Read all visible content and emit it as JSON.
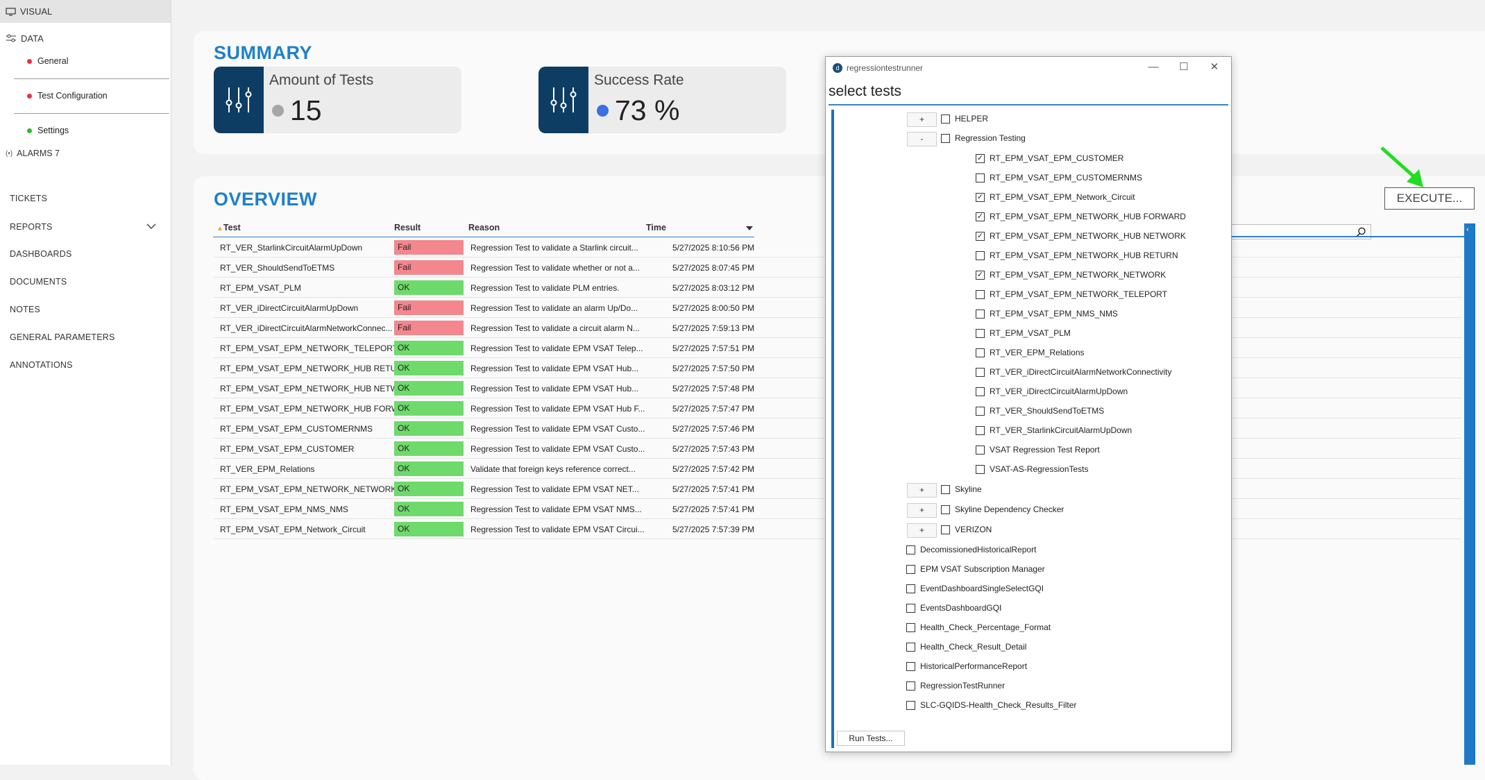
{
  "sidebar": {
    "visual_label": "VISUAL",
    "data_label": "DATA",
    "sub_items": [
      {
        "label": "General",
        "status_color": "#e8323f"
      },
      {
        "label": "Test Configuration",
        "status_color": "#e8323f"
      },
      {
        "label": "Settings",
        "status_color": "#2eb82e"
      }
    ],
    "alarms_label": "ALARMS 7",
    "nav": [
      "TICKETS",
      "REPORTS",
      "DASHBOARDS",
      "DOCUMENTS",
      "NOTES",
      "GENERAL PARAMETERS",
      "ANNOTATIONS"
    ]
  },
  "summary": {
    "title": "SUMMARY",
    "cards": [
      {
        "label": "Amount of Tests",
        "value": "15",
        "dot_color": "#a6a6a6",
        "icon": "sliders-icon"
      },
      {
        "label": "Success Rate",
        "value": "73 %",
        "dot_color": "#3c6fe0",
        "icon": "sliders-icon"
      }
    ]
  },
  "overview": {
    "title": "OVERVIEW",
    "execute_label": "EXECUTE...",
    "columns": [
      "Test",
      "Result",
      "Reason",
      "Time"
    ],
    "rows": [
      {
        "test": "RT_VER_StarlinkCircuitAlarmUpDown",
        "result": "Fail",
        "reason": "Regression Test to validate a Starlink circuit...",
        "time": "5/27/2025 8:10:56 PM"
      },
      {
        "test": "RT_VER_ShouldSendToETMS",
        "result": "Fail",
        "reason": "Regression Test to validate whether or not a...",
        "time": "5/27/2025 8:07:45 PM"
      },
      {
        "test": "RT_EPM_VSAT_PLM",
        "result": "OK",
        "reason": "Regression Test to validate PLM entries.",
        "time": "5/27/2025 8:03:12 PM"
      },
      {
        "test": "RT_VER_iDirectCircuitAlarmUpDown",
        "result": "Fail",
        "reason": "Regression Test to validate an alarm Up/Do...",
        "time": "5/27/2025 8:00:50 PM"
      },
      {
        "test": "RT_VER_iDirectCircuitAlarmNetworkConnec...",
        "result": "Fail",
        "reason": "Regression Test to validate a circuit alarm N...",
        "time": "5/27/2025 7:59:13 PM"
      },
      {
        "test": "RT_EPM_VSAT_EPM_NETWORK_TELEPORT",
        "result": "OK",
        "reason": "Regression Test to validate EPM VSAT Telep...",
        "time": "5/27/2025 7:57:51 PM"
      },
      {
        "test": "RT_EPM_VSAT_EPM_NETWORK_HUB RETURN",
        "result": "OK",
        "reason": "Regression Test to validate EPM VSAT Hub...",
        "time": "5/27/2025 7:57:50 PM"
      },
      {
        "test": "RT_EPM_VSAT_EPM_NETWORK_HUB NETW...",
        "result": "OK",
        "reason": "Regression Test to validate EPM VSAT Hub...",
        "time": "5/27/2025 7:57:48 PM"
      },
      {
        "test": "RT_EPM_VSAT_EPM_NETWORK_HUB FORW...",
        "result": "OK",
        "reason": "Regression Test to validate EPM VSAT Hub F...",
        "time": "5/27/2025 7:57:47 PM"
      },
      {
        "test": "RT_EPM_VSAT_EPM_CUSTOMERNMS",
        "result": "OK",
        "reason": "Regression Test to validate EPM VSAT Custo...",
        "time": "5/27/2025 7:57:46 PM"
      },
      {
        "test": "RT_EPM_VSAT_EPM_CUSTOMER",
        "result": "OK",
        "reason": "Regression Test to validate EPM VSAT Custo...",
        "time": "5/27/2025 7:57:43 PM"
      },
      {
        "test": "RT_VER_EPM_Relations",
        "result": "OK",
        "reason": "Validate that foreign keys reference correct...",
        "time": "5/27/2025 7:57:42 PM"
      },
      {
        "test": "RT_EPM_VSAT_EPM_NETWORK_NETWORK",
        "result": "OK",
        "reason": "Regression Test to validate EPM VSAT NET...",
        "time": "5/27/2025 7:57:41 PM"
      },
      {
        "test": "RT_EPM_VSAT_EPM_NMS_NMS",
        "result": "OK",
        "reason": "Regression Test to validate EPM VSAT NMS...",
        "time": "5/27/2025 7:57:41 PM"
      },
      {
        "test": "RT_EPM_VSAT_EPM_Network_Circuit",
        "result": "OK",
        "reason": "Regression Test to validate EPM VSAT Circui...",
        "time": "5/27/2025 7:57:39 PM"
      }
    ]
  },
  "dialog": {
    "window_title": "regressiontestrunner",
    "heading": "select tests",
    "run_label": "Run Tests...",
    "groups_top": [
      {
        "expander": "+",
        "label": "HELPER",
        "checked": false
      },
      {
        "expander": "-",
        "label": "Regression Testing",
        "checked": false
      }
    ],
    "regression_items": [
      {
        "label": "RT_EPM_VSAT_EPM_CUSTOMER",
        "checked": true
      },
      {
        "label": "RT_EPM_VSAT_EPM_CUSTOMERNMS",
        "checked": false
      },
      {
        "label": "RT_EPM_VSAT_EPM_Network_Circuit",
        "checked": true
      },
      {
        "label": "RT_EPM_VSAT_EPM_NETWORK_HUB FORWARD",
        "checked": true
      },
      {
        "label": "RT_EPM_VSAT_EPM_NETWORK_HUB NETWORK",
        "checked": true
      },
      {
        "label": "RT_EPM_VSAT_EPM_NETWORK_HUB RETURN",
        "checked": false
      },
      {
        "label": "RT_EPM_VSAT_EPM_NETWORK_NETWORK",
        "checked": true
      },
      {
        "label": "RT_EPM_VSAT_EPM_NETWORK_TELEPORT",
        "checked": false
      },
      {
        "label": "RT_EPM_VSAT_EPM_NMS_NMS",
        "checked": false
      },
      {
        "label": "RT_EPM_VSAT_PLM",
        "checked": false
      },
      {
        "label": "RT_VER_EPM_Relations",
        "checked": false
      },
      {
        "label": "RT_VER_iDirectCircuitAlarmNetworkConnectivity",
        "checked": false
      },
      {
        "label": "RT_VER_iDirectCircuitAlarmUpDown",
        "checked": false
      },
      {
        "label": "RT_VER_ShouldSendToETMS",
        "checked": false
      },
      {
        "label": "RT_VER_StarlinkCircuitAlarmUpDown",
        "checked": false
      },
      {
        "label": "VSAT Regression Test Report",
        "checked": false
      },
      {
        "label": "VSAT-AS-RegressionTests",
        "checked": false
      }
    ],
    "groups_bottom": [
      {
        "expander": "+",
        "label": "Skyline",
        "checked": false
      },
      {
        "expander": "+",
        "label": "Skyline Dependency Checker",
        "checked": false
      },
      {
        "expander": "+",
        "label": "VERIZON",
        "checked": false
      }
    ],
    "root_items": [
      {
        "label": "DecomissionedHistoricalReport",
        "checked": false
      },
      {
        "label": "EPM VSAT Subscription Manager",
        "checked": false
      },
      {
        "label": "EventDashboardSingleSelectGQI",
        "checked": false
      },
      {
        "label": "EventsDashboardGQI",
        "checked": false
      },
      {
        "label": "Health_Check_Percentage_Format",
        "checked": false
      },
      {
        "label": "Health_Check_Result_Detail",
        "checked": false
      },
      {
        "label": "HistoricalPerformanceReport",
        "checked": false
      },
      {
        "label": "RegressionTestRunner",
        "checked": false
      },
      {
        "label": "SLC-GQIDS-Health_Check_Results_Filter",
        "checked": false
      }
    ]
  },
  "colors": {
    "accent": "#1f80c8",
    "fail": "#f4868e",
    "ok": "#6fda6c",
    "annotation_arrow": "#22dd22"
  }
}
